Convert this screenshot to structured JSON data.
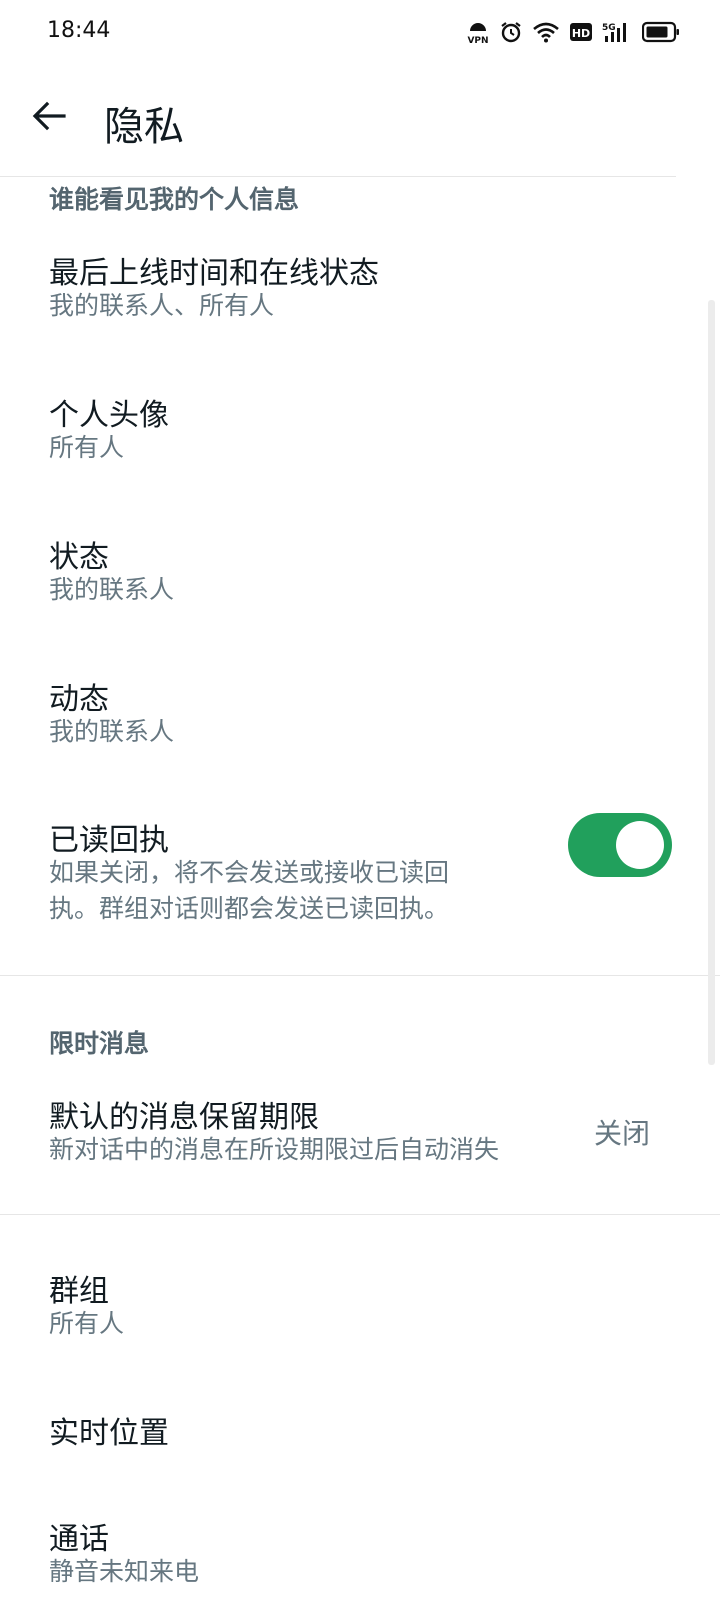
{
  "status_bar": {
    "time": "18:44",
    "icons": [
      "vpn-icon",
      "alarm-icon",
      "wifi-icon",
      "hd-icon",
      "5g-signal-icon",
      "battery-icon"
    ],
    "vpn_text": "VPN",
    "hd_text": "HD",
    "net_text": "5G"
  },
  "header": {
    "title": "隐私",
    "back_icon": "back-arrow-icon"
  },
  "section_personal": {
    "title": "谁能看见我的个人信息"
  },
  "items": {
    "last_seen": {
      "title": "最后上线时间和在线状态",
      "subtitle": "我的联系人、所有人"
    },
    "profile_photo": {
      "title": "个人头像",
      "subtitle": "所有人"
    },
    "about": {
      "title": "状态",
      "subtitle": "我的联系人"
    },
    "status": {
      "title": "动态",
      "subtitle": "我的联系人"
    },
    "read_receipts": {
      "title": "已读回执",
      "subtitle_line1": "如果关闭，将不会发送或接收已读回",
      "subtitle_line2": "执。群组对话则都会发送已读回执。",
      "enabled": true
    },
    "default_timer": {
      "title": "默认的消息保留期限",
      "subtitle": "新对话中的消息在所设期限过后自动消失",
      "value": "关闭"
    },
    "groups": {
      "title": "群组",
      "subtitle": "所有人"
    },
    "live_location": {
      "title": "实时位置"
    },
    "calls": {
      "title": "通话",
      "subtitle": "静音未知来电"
    }
  },
  "section_disappearing": {
    "title": "限时消息"
  },
  "colors": {
    "accent": "#21a05c",
    "title_text": "#111b21",
    "secondary_text": "#667781",
    "section_text": "#54656f"
  }
}
